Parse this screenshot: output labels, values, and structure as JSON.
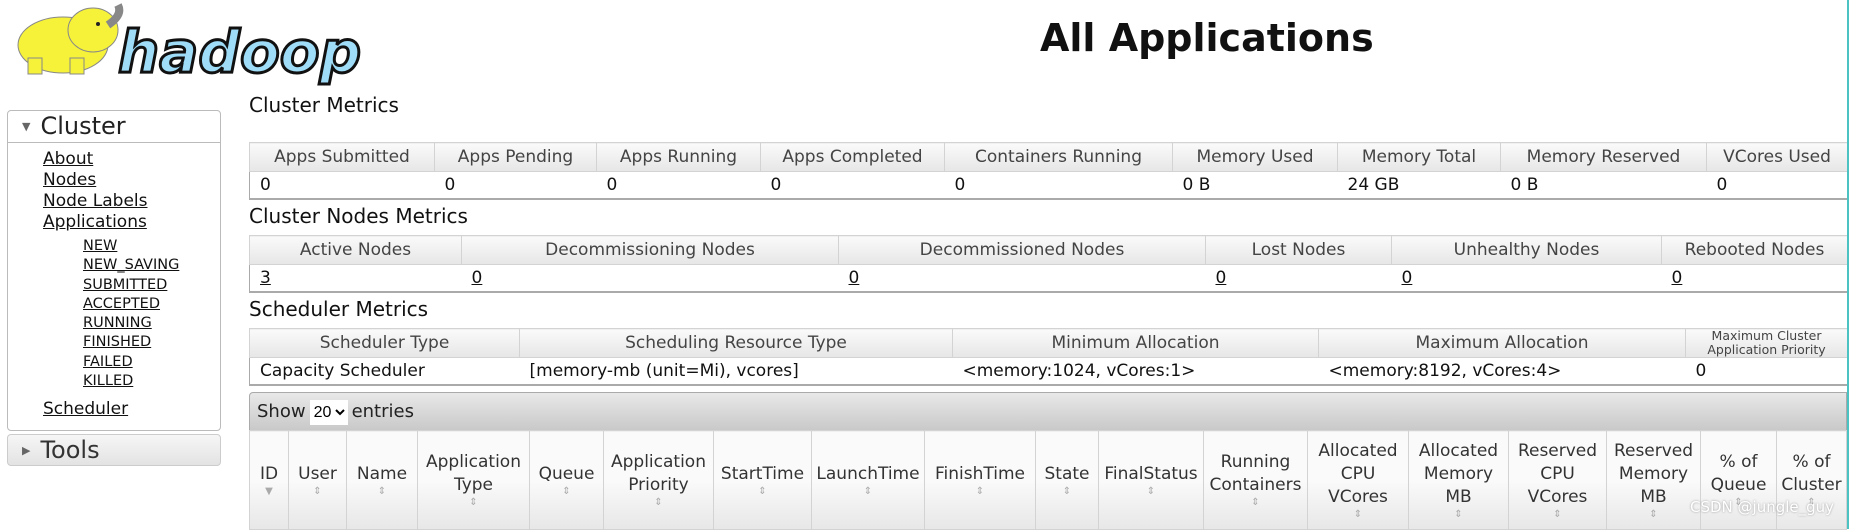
{
  "logo_text": "hadoop",
  "title": "All Applications",
  "sidebar": {
    "cluster": "Cluster",
    "links": [
      "About",
      "Nodes",
      "Node Labels",
      "Applications"
    ],
    "app_states": [
      "NEW",
      "NEW_SAVING",
      "SUBMITTED",
      "ACCEPTED",
      "RUNNING",
      "FINISHED",
      "FAILED",
      "KILLED"
    ],
    "scheduler": "Scheduler",
    "tools": "Tools"
  },
  "cluster_metrics": {
    "title": "Cluster Metrics",
    "headers": [
      "Apps Submitted",
      "Apps Pending",
      "Apps Running",
      "Apps Completed",
      "Containers Running",
      "Memory Used",
      "Memory Total",
      "Memory Reserved",
      "VCores Used"
    ],
    "values": [
      "0",
      "0",
      "0",
      "0",
      "0",
      "0 B",
      "24 GB",
      "0 B",
      "0"
    ]
  },
  "node_metrics": {
    "title": "Cluster Nodes Metrics",
    "headers": [
      "Active Nodes",
      "Decommissioning Nodes",
      "Decommissioned Nodes",
      "Lost Nodes",
      "Unhealthy Nodes",
      "Rebooted Nodes"
    ],
    "values": [
      "3",
      "0",
      "0",
      "0",
      "0",
      "0"
    ]
  },
  "scheduler_metrics": {
    "title": "Scheduler Metrics",
    "headers": [
      "Scheduler Type",
      "Scheduling Resource Type",
      "Minimum Allocation",
      "Maximum Allocation",
      "Maximum Cluster Application Priority"
    ],
    "values": [
      "Capacity Scheduler",
      "[memory-mb (unit=Mi), vcores]",
      "<memory:1024, vCores:1>",
      "<memory:8192, vCores:4>",
      "0"
    ]
  },
  "entries": {
    "show": "Show",
    "value": "20",
    "suffix": "entries"
  },
  "apps_table": {
    "headers": [
      "ID",
      "User",
      "Name",
      "Application Type",
      "Queue",
      "Application Priority",
      "StartTime",
      "LaunchTime",
      "FinishTime",
      "State",
      "FinalStatus",
      "Running Containers",
      "Allocated CPU VCores",
      "Allocated Memory MB",
      "Reserved CPU VCores",
      "Reserved Memory MB",
      "% of Queue",
      "% of Cluster"
    ]
  },
  "watermark": "CSDN @jungle_guy",
  "colors": {
    "logo_blue": "#9fdcf7",
    "logo_yellow": "#f6f23a",
    "scrollbar": "#4cc3c3"
  }
}
